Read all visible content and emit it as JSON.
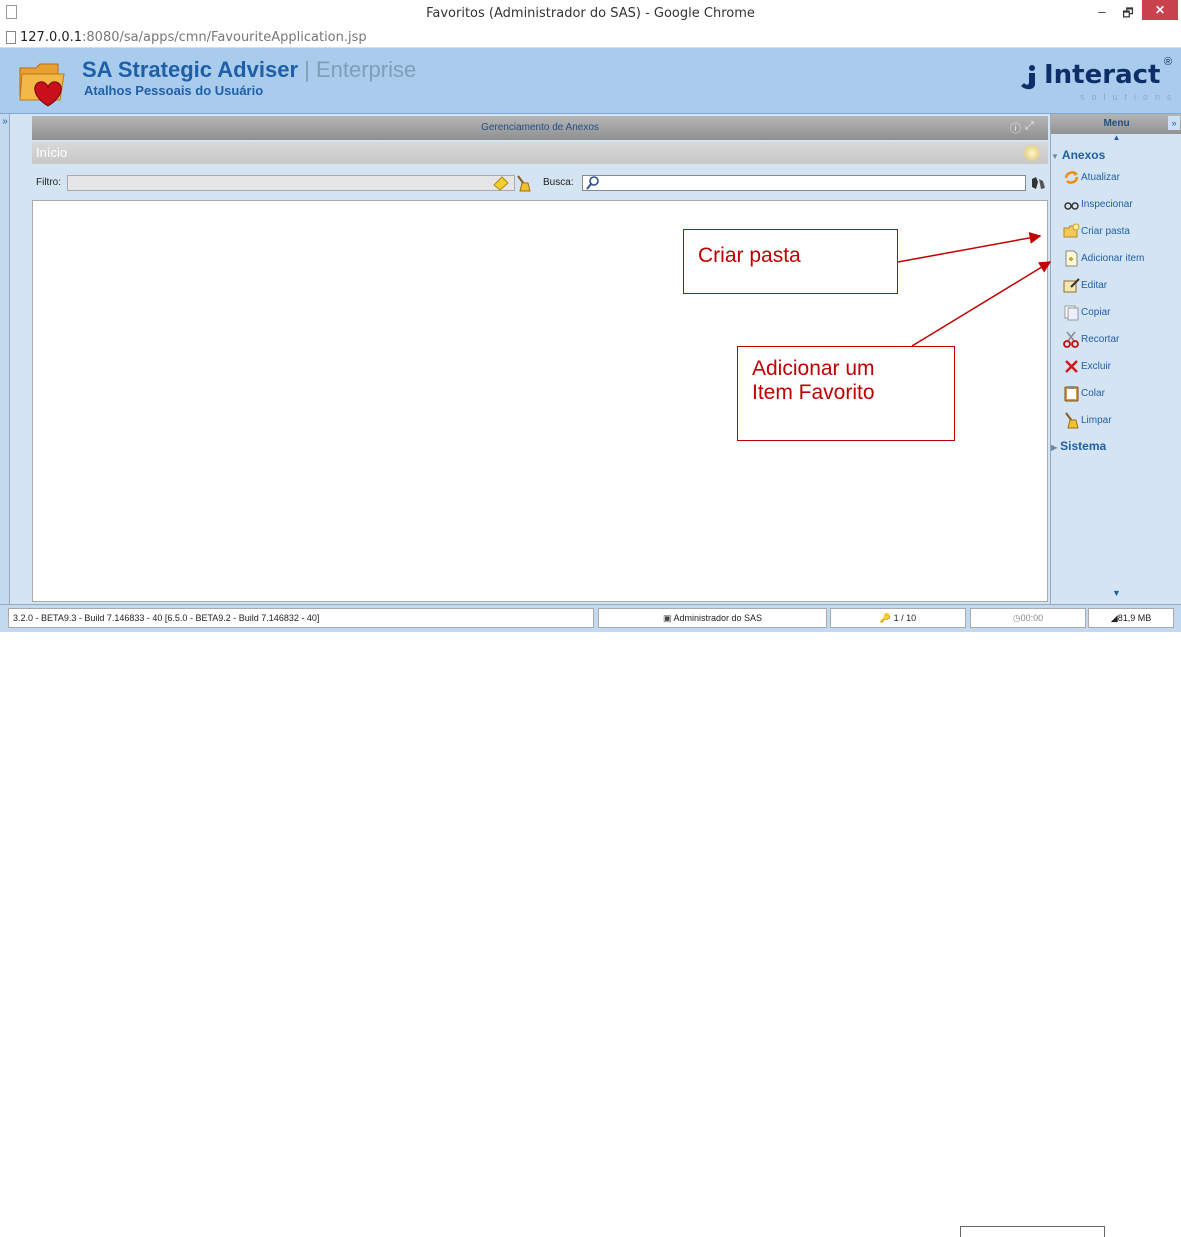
{
  "window": {
    "title": "Favoritos (Administrador do SAS) - Google Chrome",
    "minimize": "–",
    "maximize": "🗗",
    "close": "✕"
  },
  "urlbar": {
    "host": "127.0.0.1",
    "path": ":8080/sa/apps/cmn/FavouriteApplication.jsp"
  },
  "header": {
    "title": "SA Strategic Adviser",
    "separator": " | ",
    "edition": "Enterprise",
    "subtitle": "Atalhos Pessoais do Usuário",
    "brand": "Interact",
    "brand_sub": "solutions",
    "brand_reg": "®"
  },
  "leftstrip": {
    "toggle": "»"
  },
  "panel": {
    "title": "Gerenciamento de Anexos",
    "info": "ⓘ",
    "expand": "⤢",
    "breadcrumb": "Início"
  },
  "filterbar": {
    "filter_label": "Filtro:",
    "filter_value": "",
    "search_label": "Busca:",
    "search_value": ""
  },
  "annotations": {
    "criar_pasta": "Criar pasta",
    "adicionar_line1": "Adicionar um",
    "adicionar_line2": "Item Favorito"
  },
  "menu": {
    "title": "Menu",
    "toggle": "»",
    "scroll_up": "▲",
    "scroll_down": "▼",
    "groups": [
      {
        "title": "Anexos",
        "expanded": true,
        "items": [
          {
            "label": "Atualizar",
            "icon": "refresh-icon"
          },
          {
            "label": "Inspecionar",
            "icon": "glasses-icon"
          },
          {
            "label": "Criar pasta",
            "icon": "folder-new-icon"
          },
          {
            "label": "Adicionar item",
            "icon": "document-add-icon"
          },
          {
            "label": "Editar",
            "icon": "edit-icon"
          },
          {
            "label": "Copiar",
            "icon": "copy-icon"
          },
          {
            "label": "Recortar",
            "icon": "scissors-icon"
          },
          {
            "label": "Excluir",
            "icon": "delete-icon"
          },
          {
            "label": "Colar",
            "icon": "paste-icon"
          },
          {
            "label": "Limpar",
            "icon": "broom-icon"
          }
        ]
      },
      {
        "title": "Sistema",
        "expanded": false,
        "items": []
      }
    ]
  },
  "statusbar": {
    "version": "3.2.0 - BETA9.3 - Build 7.146833 - 40 [6.5.0 - BETA9.2 - Build 7.146832 - 40]",
    "user": "Administrador do SAS",
    "session": "1 / 10",
    "time": "00:00",
    "memory": "81,9 MB"
  },
  "colors": {
    "header_bg": "#a9ccec",
    "brand_blue": "#1f5fa8",
    "annotation_red": "#c00000"
  }
}
